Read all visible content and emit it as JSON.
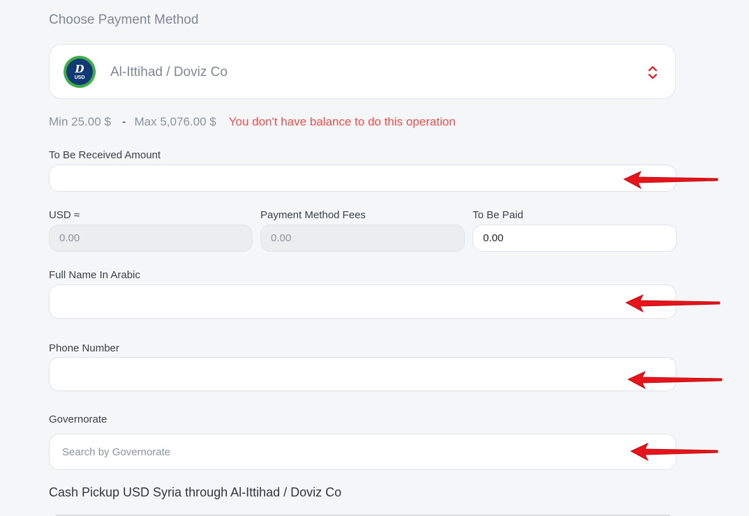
{
  "section_title": "Choose Payment Method",
  "payment_method": {
    "logo_mark": "D",
    "logo_currency": "USD",
    "name": "Al-Ittihad / Doviz Co",
    "icon": "chevron-updown-icon"
  },
  "limits": {
    "min": "Min 25.00 $",
    "separator": "-",
    "max": "Max 5,076.00 $",
    "error": "You don't have balance to do this operation"
  },
  "fields": {
    "received_amount": {
      "label": "To Be Received Amount",
      "value": ""
    },
    "usd": {
      "label": "USD ≈",
      "placeholder": "0.00"
    },
    "fees": {
      "label": "Payment Method Fees",
      "placeholder": "0.00"
    },
    "to_be_paid": {
      "label": "To Be Paid",
      "value": "0.00"
    },
    "full_name": {
      "label": "Full Name In Arabic",
      "value": ""
    },
    "phone": {
      "label": "Phone Number",
      "value": ""
    },
    "governorate": {
      "label": "Governorate",
      "placeholder": "Search by Governorate"
    }
  },
  "footer_title": "Cash Pickup USD Syria through Al-Ittihad / Doviz Co",
  "colors": {
    "error": "#ef4d4d",
    "annotation_arrow": "#e8141b",
    "logo_ring": "#3fae49",
    "logo_fill": "#123a72"
  }
}
